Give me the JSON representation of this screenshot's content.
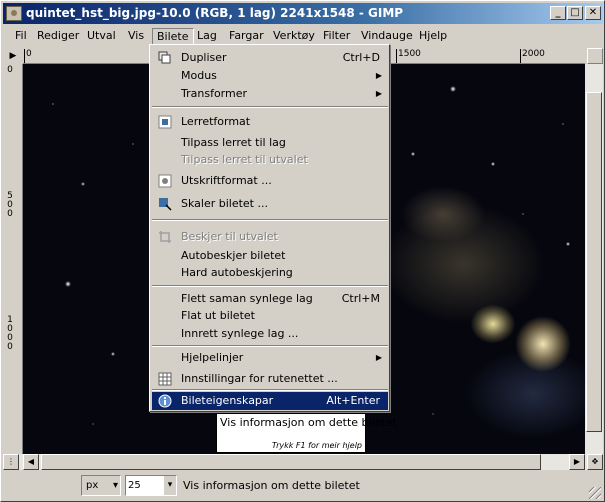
{
  "window": {
    "title": "quintet_hst_big.jpg-10.0 (RGB, 1 lag) 2241x1548 - GIMP",
    "minimize": "_",
    "maximize": "□",
    "close": "✕"
  },
  "menubar": [
    {
      "label": "Fil"
    },
    {
      "label": "Rediger"
    },
    {
      "label": "Utval"
    },
    {
      "label": "Vis"
    },
    {
      "label": "Bilete"
    },
    {
      "label": "Lag"
    },
    {
      "label": "Fargar"
    },
    {
      "label": "Verktøy"
    },
    {
      "label": "Filter"
    },
    {
      "label": "Vindauge"
    },
    {
      "label": "Hjelp"
    }
  ],
  "rulers": {
    "horizontal_ticks": [
      "0",
      "1500",
      "2000"
    ],
    "vertical_ticks": [
      "0",
      "5\n0\n0",
      "1\n0\n0\n0"
    ]
  },
  "image_menu": {
    "items": [
      {
        "label": "Dupliser",
        "shortcut": "Ctrl+D",
        "icon": "duplicate-icon"
      },
      {
        "label": "Modus",
        "submenu": "▶"
      },
      {
        "label": "Transformer",
        "submenu": "▶"
      },
      {
        "label": "Lerretformat",
        "icon": "canvas-size-icon"
      },
      {
        "label": "Tilpass lerret til lag"
      },
      {
        "label": "Tilpass lerret til utvalet",
        "disabled": true
      },
      {
        "label": "Utskriftformat ...",
        "icon": "print-size-icon"
      },
      {
        "label": "Skaler biletet ...",
        "icon": "scale-icon"
      },
      {
        "label": "Beskjer til utvalet",
        "disabled": true,
        "icon": "crop-icon"
      },
      {
        "label": "Autobeskjer biletet"
      },
      {
        "label": "Hard autobeskjering"
      },
      {
        "label": "Flett saman synlege lag",
        "shortcut": "Ctrl+M"
      },
      {
        "label": "Flat ut biletet"
      },
      {
        "label": "Innrett synlege lag ..."
      },
      {
        "label": "Hjelpelinjer",
        "submenu": "▶"
      },
      {
        "label": "Innstillingar for rutenettet ...",
        "icon": "grid-icon"
      },
      {
        "label": "Bileteigenskapar",
        "shortcut": "Alt+Enter",
        "icon": "info-icon",
        "highlighted": true
      }
    ]
  },
  "tooltip": {
    "text": "Vis informasjon om dette biletet",
    "hint": "Trykk F1 for meir hjelp"
  },
  "statusbar": {
    "unit": "px",
    "zoom": "25",
    "message": "Vis informasjon om dette biletet"
  },
  "colors": {
    "highlight": "#0a246a",
    "titlebar_start": "#0a246a",
    "titlebar_end": "#a6caf0"
  }
}
